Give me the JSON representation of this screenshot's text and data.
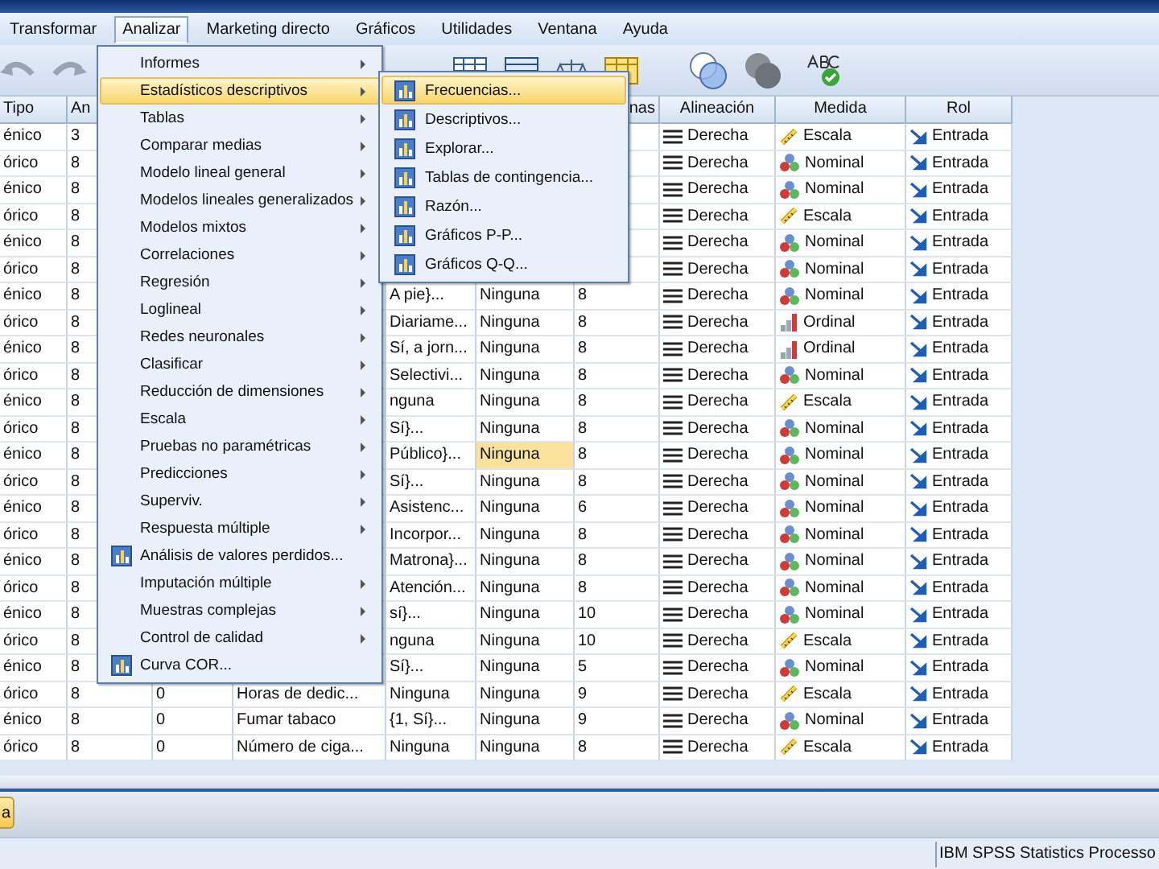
{
  "menubar": {
    "items": [
      {
        "label": "Transformar",
        "selected": false
      },
      {
        "label": "Analizar",
        "selected": true
      },
      {
        "label": "Marketing directo",
        "selected": false
      },
      {
        "label": "Gráficos",
        "selected": false
      },
      {
        "label": "Utilidades",
        "selected": false
      },
      {
        "label": "Ventana",
        "selected": false
      },
      {
        "label": "Ayuda",
        "selected": false
      }
    ]
  },
  "grid": {
    "headers": {
      "tipo": "Tipo",
      "column_2": "An",
      "column_7": "nas",
      "alineacion": "Alineación",
      "medida": "Medida",
      "rol": "Rol"
    },
    "rows": [
      {
        "tipo": "énico",
        "column_2": "3",
        "alineacion": "Derecha",
        "medida": "Escala",
        "kind": "scale",
        "rol": "Entrada"
      },
      {
        "tipo": "órico",
        "column_2": "8",
        "alineacion": "Derecha",
        "medida": "Nominal",
        "kind": "nominal",
        "rol": "Entrada"
      },
      {
        "tipo": "énico",
        "column_2": "8",
        "alineacion": "Derecha",
        "medida": "Nominal",
        "kind": "nominal",
        "rol": "Entrada"
      },
      {
        "tipo": "órico",
        "column_2": "8",
        "alineacion": "Derecha",
        "medida": "Escala",
        "kind": "scale",
        "rol": "Entrada"
      },
      {
        "tipo": "énico",
        "column_2": "8",
        "alineacion": "Derecha",
        "medida": "Nominal",
        "kind": "nominal",
        "rol": "Entrada"
      },
      {
        "tipo": "órico",
        "column_2": "8",
        "alineacion": "Derecha",
        "medida": "Nominal",
        "kind": "nominal",
        "rol": "Entrada"
      },
      {
        "tipo": "énico",
        "column_2": "8",
        "column_5": "A pie}...",
        "column_6": "Ninguna",
        "column_7": "8",
        "alineacion": "Derecha",
        "medida": "Nominal",
        "kind": "nominal",
        "rol": "Entrada",
        "selected": false
      },
      {
        "tipo": "órico",
        "column_2": "8",
        "column_5": "Diariame...",
        "column_6": "Ninguna",
        "column_7": "8",
        "alineacion": "Derecha",
        "medida": "Ordinal",
        "kind": "ordinal",
        "rol": "Entrada",
        "selected": false
      },
      {
        "tipo": "énico",
        "column_2": "8",
        "column_5": "Sí, a jorn...",
        "column_6": "Ninguna",
        "column_7": "8",
        "alineacion": "Derecha",
        "medida": "Ordinal",
        "kind": "ordinal",
        "rol": "Entrada",
        "selected": false
      },
      {
        "tipo": "órico",
        "column_2": "8",
        "column_5": "Selectivi...",
        "column_6": "Ninguna",
        "column_7": "8",
        "alineacion": "Derecha",
        "medida": "Nominal",
        "kind": "nominal",
        "rol": "Entrada",
        "selected": false
      },
      {
        "tipo": "énico",
        "column_2": "8",
        "column_5": "nguna",
        "column_6": "Ninguna",
        "column_7": "8",
        "alineacion": "Derecha",
        "medida": "Escala",
        "kind": "scale",
        "rol": "Entrada",
        "selected": false
      },
      {
        "tipo": "órico",
        "column_2": "8",
        "column_5": "Sí}...",
        "column_6": "Ninguna",
        "column_7": "8",
        "alineacion": "Derecha",
        "medida": "Nominal",
        "kind": "nominal",
        "rol": "Entrada",
        "selected": false
      },
      {
        "tipo": "énico",
        "column_2": "8",
        "column_5": "Público}...",
        "column_6": "Ninguna",
        "column_7": "8",
        "alineacion": "Derecha",
        "medida": "Nominal",
        "kind": "nominal",
        "rol": "Entrada",
        "selected": true
      },
      {
        "tipo": "órico",
        "column_2": "8",
        "column_5": "Sí}...",
        "column_6": "Ninguna",
        "column_7": "8",
        "alineacion": "Derecha",
        "medida": "Nominal",
        "kind": "nominal",
        "rol": "Entrada",
        "selected": false
      },
      {
        "tipo": "énico",
        "column_2": "8",
        "column_5": "Asistenc...",
        "column_6": "Ninguna",
        "column_7": "6",
        "alineacion": "Derecha",
        "medida": "Nominal",
        "kind": "nominal",
        "rol": "Entrada",
        "selected": false
      },
      {
        "tipo": "órico",
        "column_2": "8",
        "column_5": "Incorpor...",
        "column_6": "Ninguna",
        "column_7": "8",
        "alineacion": "Derecha",
        "medida": "Nominal",
        "kind": "nominal",
        "rol": "Entrada",
        "selected": false
      },
      {
        "tipo": "énico",
        "column_2": "8",
        "column_5": "Matrona}...",
        "column_6": "Ninguna",
        "column_7": "8",
        "alineacion": "Derecha",
        "medida": "Nominal",
        "kind": "nominal",
        "rol": "Entrada",
        "selected": false
      },
      {
        "tipo": "órico",
        "column_2": "8",
        "column_5": "Atención...",
        "column_6": "Ninguna",
        "column_7": "8",
        "alineacion": "Derecha",
        "medida": "Nominal",
        "kind": "nominal",
        "rol": "Entrada",
        "selected": false
      },
      {
        "tipo": "énico",
        "column_2": "8",
        "column_5": "sí}...",
        "column_6": "Ninguna",
        "column_7": "10",
        "alineacion": "Derecha",
        "medida": "Nominal",
        "kind": "nominal",
        "rol": "Entrada",
        "selected": false
      },
      {
        "tipo": "órico",
        "column_2": "8",
        "column_5": "nguna",
        "column_6": "Ninguna",
        "column_7": "10",
        "alineacion": "Derecha",
        "medida": "Escala",
        "kind": "scale",
        "rol": "Entrada",
        "selected": false
      },
      {
        "tipo": "énico",
        "column_2": "8",
        "column_5": "Sí}...",
        "column_6": "Ninguna",
        "column_7": "5",
        "alineacion": "Derecha",
        "medida": "Nominal",
        "kind": "nominal",
        "rol": "Entrada",
        "selected": false
      },
      {
        "tipo": "órico",
        "column_2": "8",
        "column_3": "0",
        "column_4": "Horas de dedic...",
        "column_5": "Ninguna",
        "column_6": "Ninguna",
        "column_7": "9",
        "alineacion": "Derecha",
        "medida": "Escala",
        "kind": "scale",
        "rol": "Entrada",
        "selected": false
      },
      {
        "tipo": "énico",
        "column_2": "8",
        "column_3": "0",
        "column_4": "Fumar tabaco",
        "column_5": "{1, Sí}...",
        "column_6": "Ninguna",
        "column_7": "9",
        "alineacion": "Derecha",
        "medida": "Nominal",
        "kind": "nominal",
        "rol": "Entrada",
        "selected": false
      },
      {
        "tipo": "órico",
        "column_2": "8",
        "column_3": "0",
        "column_4": "Número de ciga...",
        "column_5": "Ninguna",
        "column_6": "Ninguna",
        "column_7": "8",
        "alineacion": "Derecha",
        "medida": "Escala",
        "kind": "scale",
        "rol": "Entrada",
        "selected": false
      }
    ]
  },
  "analizar_menu": {
    "items": [
      {
        "label": "Informes",
        "kind": "submenu",
        "selected": false
      },
      {
        "label": "Estadísticos descriptivos",
        "kind": "submenu",
        "selected": true
      },
      {
        "label": "Tablas",
        "kind": "submenu",
        "selected": false
      },
      {
        "label": "Comparar medias",
        "kind": "submenu",
        "selected": false
      },
      {
        "label": "Modelo lineal general",
        "kind": "submenu",
        "selected": false
      },
      {
        "label": "Modelos lineales generalizados",
        "kind": "submenu",
        "selected": false
      },
      {
        "label": "Modelos mixtos",
        "kind": "submenu",
        "selected": false
      },
      {
        "label": "Correlaciones",
        "kind": "submenu",
        "selected": false
      },
      {
        "label": "Regresión",
        "kind": "submenu",
        "selected": false
      },
      {
        "label": "Loglineal",
        "kind": "submenu",
        "selected": false
      },
      {
        "label": "Redes neuronales",
        "kind": "submenu",
        "selected": false
      },
      {
        "label": "Clasificar",
        "kind": "submenu",
        "selected": false
      },
      {
        "label": "Reducción de dimensiones",
        "kind": "submenu",
        "selected": false
      },
      {
        "label": "Escala",
        "kind": "submenu",
        "selected": false
      },
      {
        "label": "Pruebas no paramétricas",
        "kind": "submenu",
        "selected": false
      },
      {
        "label": "Predicciones",
        "kind": "submenu",
        "selected": false
      },
      {
        "label": "Superviv.",
        "kind": "submenu",
        "selected": false
      },
      {
        "label": "Respuesta múltiple",
        "kind": "submenu",
        "selected": false
      },
      {
        "label": "Análisis de valores perdidos...",
        "kind": "command",
        "selected": false
      },
      {
        "label": "Imputación múltiple",
        "kind": "submenu",
        "selected": false
      },
      {
        "label": "Muestras complejas",
        "kind": "submenu",
        "selected": false
      },
      {
        "label": "Control de calidad",
        "kind": "submenu",
        "selected": false
      },
      {
        "label": "Curva COR...",
        "kind": "command",
        "selected": false
      }
    ]
  },
  "descriptivos_submenu": {
    "items": [
      {
        "label": "Frecuencias...",
        "selected": true
      },
      {
        "label": "Descriptivos...",
        "selected": false
      },
      {
        "label": "Explorar...",
        "selected": false
      },
      {
        "label": "Tablas de contingencia...",
        "selected": false
      },
      {
        "label": "Razón...",
        "selected": false
      },
      {
        "label": "Gráficos P-P...",
        "selected": false
      },
      {
        "label": "Gráficos Q-Q...",
        "selected": false
      }
    ]
  },
  "sheet_tabs": [
    {
      "label": "a",
      "selected": true
    }
  ],
  "status_bar": {
    "processor": "IBM SPSS Statistics Processo"
  }
}
